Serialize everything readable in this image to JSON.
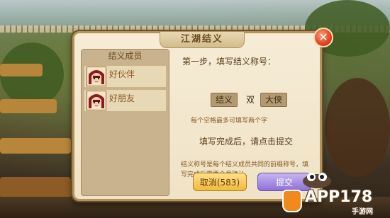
{
  "dialog": {
    "title": "江湖结义",
    "close_icon": "close-x-icon",
    "members": {
      "header": "结义成员",
      "items": [
        {
          "name": "好伙伴",
          "avatar": "hero-avatar"
        },
        {
          "name": "好朋友",
          "avatar": "hero-avatar"
        }
      ]
    },
    "step": "第一步，填写结义称号：",
    "title_parts": {
      "first": "结义",
      "middle": "双",
      "second": "大侠"
    },
    "hint_small": "每个空格最多可填写两个字",
    "hint_main": "填写完成后，请点击提交",
    "notice": "结义称号是每个结义成员共同的前缀称号，填写完成后需要全员确认。",
    "buttons": {
      "cancel": "取消(583)",
      "submit": "提交"
    }
  },
  "watermark": {
    "text": "APP178",
    "sub": "手游网"
  },
  "colors": {
    "panel": "#efe2c6",
    "border": "#b4925c",
    "cancel_button": "#f3b93d",
    "submit_button": "#8e6fd6",
    "close_button": "#e34224"
  }
}
